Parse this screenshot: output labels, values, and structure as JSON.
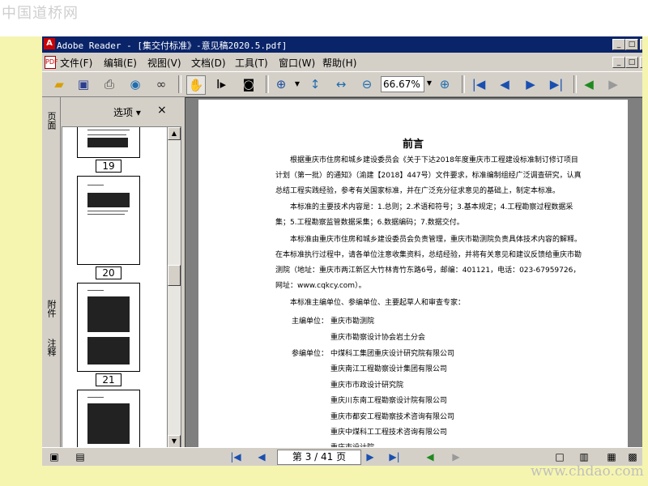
{
  "watermark_top": "中国道桥网",
  "watermark_bottom": "www.chdao.com",
  "window": {
    "title": "Adobe Reader - [集交付标准》-意见稿2020.5.pdf]",
    "app_icon_text": "A",
    "min_glyph": "_",
    "max_glyph": "□",
    "close_glyph": "×"
  },
  "menu": {
    "items": [
      "文件(F)",
      "编辑(E)",
      "视图(V)",
      "文档(D)",
      "工具(T)",
      "窗口(W)",
      "帮助(H)"
    ]
  },
  "toolbar": {
    "zoom_value": "66.67%"
  },
  "nav_pane": {
    "tabs": [
      "页面",
      "附件",
      "注释"
    ],
    "options_label": "选项 ▾",
    "close_label": "×",
    "thumbnail_labels": [
      "19",
      "20",
      "21"
    ]
  },
  "document": {
    "heading": "前言",
    "paragraphs": [
      "根据重庆市住房和城乡建设委员会《关于下达2018年度重庆市工程建设标准制订修订项目计划（第一批）的通知》（渝建【2018】447号）文件要求，标准编制组经广泛调查研究，认真总结工程实践经验，参考有关国家标准，并在广泛充分征求意见的基础上，制定本标准。",
      "本标准的主要技术内容是：1.总则；2.术语和符号；3.基本规定；4.工程勘察过程数据采集；5.工程勘察监管数据采集；6.数据编码；7.数据交付。",
      "本标准由重庆市住房和城乡建设委员会负责管理，重庆市勘测院负责具体技术内容的解释。在本标准执行过程中，请各单位注意收集资料，总结经验，并将有关意见和建议反馈给重庆市勘测院（地址：重庆市两江新区大竹林青竹东路6号，邮编：401121，电话：023-67959726，网址：www.cqkcy.com）。",
      "本标准主编单位、参编单位、主要起草人和审查专家："
    ],
    "chief_label": "主编单位：",
    "chief_units": [
      "重庆市勘测院",
      "重庆市勘察设计协会岩土分会"
    ],
    "participant_label": "参编单位：",
    "participant_units": [
      "中煤科工集团重庆设计研究院有限公司",
      "重庆南江工程勘察设计集团有限公司",
      "重庆市市政设计研究院",
      "重庆川东南工程勘察设计院有限公司",
      "重庆市都安工程勘察技术咨询有限公司",
      "重庆中煤科工工程技术咨询有限公司",
      "重庆市设计院"
    ]
  },
  "status": {
    "page_display": "第 3 / 41 页"
  }
}
